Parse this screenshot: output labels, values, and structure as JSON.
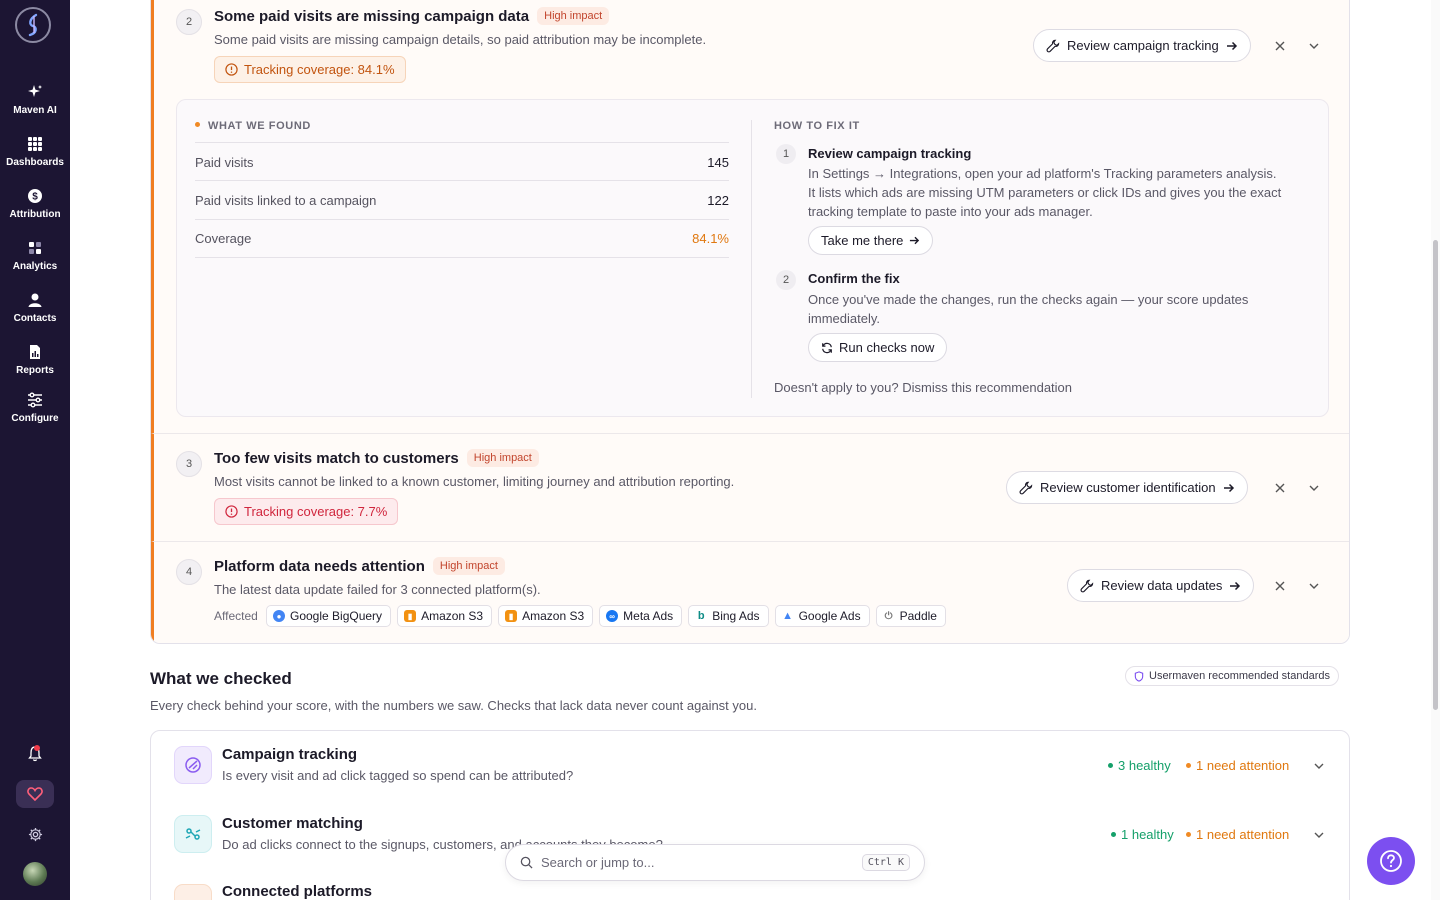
{
  "sidebar": {
    "items": [
      {
        "label": "Maven AI",
        "icon": "sparkles-icon"
      },
      {
        "label": "Dashboards",
        "icon": "grid-icon"
      },
      {
        "label": "Attribution",
        "icon": "dollar-icon"
      },
      {
        "label": "Analytics",
        "icon": "analytics-icon"
      },
      {
        "label": "Contacts",
        "icon": "person-icon"
      },
      {
        "label": "Reports",
        "icon": "report-icon"
      },
      {
        "label": "Configure",
        "icon": "sliders-icon"
      }
    ]
  },
  "recommendations": [
    {
      "number": "2",
      "title": "Some paid visits are missing campaign data",
      "impact": "High impact",
      "description": "Some paid visits are missing campaign details, so paid attribution may be incomplete.",
      "coverage": "Tracking coverage: 84.1%",
      "action": "Review campaign tracking",
      "expanded": true,
      "found": {
        "heading": "WHAT WE FOUND",
        "rows": [
          {
            "label": "Paid visits",
            "value": "145"
          },
          {
            "label": "Paid visits linked to a campaign",
            "value": "122"
          },
          {
            "label": "Coverage",
            "value": "84.1%"
          }
        ]
      },
      "fix": {
        "heading": "HOW TO FIX IT",
        "steps": [
          {
            "number": "1",
            "title": "Review campaign tracking",
            "lines": [
              "In Settings → Integrations, open your ad platform's Tracking parameters analysis.",
              "It lists which ads are missing UTM parameters or click IDs and gives you the exact",
              "tracking template to paste into your ads manager."
            ],
            "button": "Take me there"
          },
          {
            "number": "2",
            "title": "Confirm the fix",
            "lines": [
              "Once you've made the changes, run the checks again — your score updates",
              "immediately."
            ],
            "button": "Run checks now"
          }
        ],
        "dismiss": "Doesn't apply to you? Dismiss this recommendation"
      }
    },
    {
      "number": "3",
      "title": "Too few visits match to customers",
      "impact": "High impact",
      "description": "Most visits cannot be linked to a known customer, limiting journey and attribution reporting.",
      "coverage": "Tracking coverage: 7.7%",
      "action": "Review customer identification"
    },
    {
      "number": "4",
      "title": "Platform data needs attention",
      "impact": "High impact",
      "description": "The latest data update failed for 3 connected platform(s).",
      "affected_label": "Affected",
      "affected": [
        "Google BigQuery",
        "Amazon S3",
        "Amazon S3",
        "Meta Ads",
        "Bing Ads",
        "Google Ads",
        "Paddle"
      ],
      "action": "Review data updates"
    }
  ],
  "checked": {
    "title": "What we checked",
    "subtitle": "Every check behind your score, with the numbers we saw. Checks that lack data never count against you.",
    "standards": "Usermaven recommended standards",
    "checks": [
      {
        "title": "Campaign tracking",
        "question": "Is every visit and ad click tagged so spend can be attributed?",
        "healthy": "3 healthy",
        "attention": "1 need attention"
      },
      {
        "title": "Customer matching",
        "question": "Do ad clicks connect to the signups, customers, and accounts they become?",
        "healthy": "1 healthy",
        "attention": "1 need attention"
      },
      {
        "title": "Connected platforms",
        "question": ""
      }
    ]
  },
  "search": {
    "placeholder": "Search or jump to...",
    "shortcut": "Ctrl K"
  },
  "colors": {
    "sidebar": "#1c1533",
    "accent": "#7c4ff0",
    "warning": "#f07e22",
    "danger": "#d0263d",
    "healthy": "#15a06a"
  }
}
